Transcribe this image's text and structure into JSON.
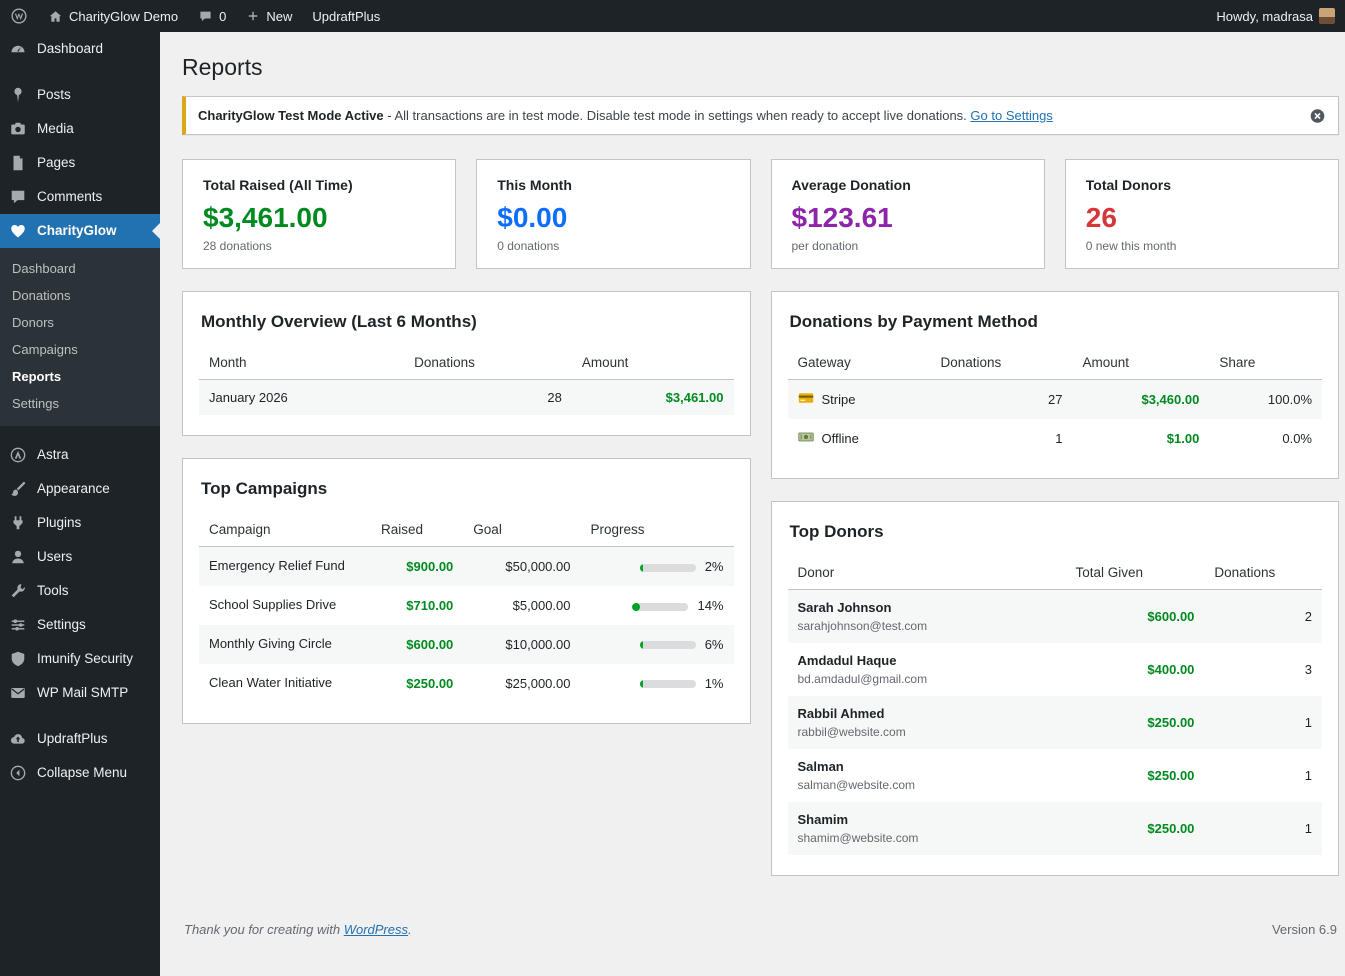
{
  "colors": {
    "admin_bar_bg": "#1d2327",
    "sidebar_bg": "#1d2327",
    "submenu_bg": "#2c3338",
    "active_menu": "#2271b1",
    "content_bg": "#f0f0f1",
    "warning_border": "#dba617",
    "money_green": "#008a20",
    "progress_green": "#00a32a",
    "stat_blue": "#0d6efd",
    "stat_purple": "#8e24aa",
    "stat_red": "#d63638",
    "link": "#2271b1"
  },
  "admin_bar": {
    "site_name": "CharityGlow Demo",
    "comments_count": "0",
    "new_label": "New",
    "updraft_label": "UpdraftPlus",
    "howdy": "Howdy, madrasa"
  },
  "sidebar": {
    "items": [
      {
        "label": "Dashboard",
        "icon": "dashboard-icon"
      },
      {
        "label": "Posts",
        "icon": "pin-icon"
      },
      {
        "label": "Media",
        "icon": "camera-icon"
      },
      {
        "label": "Pages",
        "icon": "pages-icon"
      },
      {
        "label": "Comments",
        "icon": "comment-icon"
      },
      {
        "label": "CharityGlow",
        "icon": "heart-icon",
        "active": true
      },
      {
        "label": "Astra",
        "icon": "astra-icon"
      },
      {
        "label": "Appearance",
        "icon": "brush-icon"
      },
      {
        "label": "Plugins",
        "icon": "plug-icon"
      },
      {
        "label": "Users",
        "icon": "user-icon"
      },
      {
        "label": "Tools",
        "icon": "wrench-icon"
      },
      {
        "label": "Settings",
        "icon": "sliders-icon"
      },
      {
        "label": "Imunify Security",
        "icon": "shield-icon"
      },
      {
        "label": "WP Mail SMTP",
        "icon": "envelope-icon"
      },
      {
        "label": "UpdraftPlus",
        "icon": "cloud-backup-icon"
      },
      {
        "label": "Collapse Menu",
        "icon": "collapse-icon"
      }
    ],
    "submenu": [
      {
        "label": "Dashboard"
      },
      {
        "label": "Donations"
      },
      {
        "label": "Donors"
      },
      {
        "label": "Campaigns"
      },
      {
        "label": "Reports",
        "active": true
      },
      {
        "label": "Settings"
      }
    ]
  },
  "page": {
    "title": "Reports"
  },
  "notice": {
    "bold": "CharityGlow Test Mode Active",
    "text": " - All transactions are in test mode. Disable test mode in settings when ready to accept live donations. ",
    "link": "Go to Settings"
  },
  "stats": [
    {
      "title": "Total Raised (All Time)",
      "value": "$3,461.00",
      "sub": "28 donations",
      "color": "#008a20"
    },
    {
      "title": "This Month",
      "value": "$0.00",
      "sub": "0 donations",
      "color": "#0d6efd"
    },
    {
      "title": "Average Donation",
      "value": "$123.61",
      "sub": "per donation",
      "color": "#8e24aa"
    },
    {
      "title": "Total Donors",
      "value": "26",
      "sub": "0 new this month",
      "color": "#d63638"
    }
  ],
  "monthly_overview": {
    "title": "Monthly Overview (Last 6 Months)",
    "columns": [
      "Month",
      "Donations",
      "Amount"
    ],
    "rows": [
      {
        "month": "January 2026",
        "donations": "28",
        "amount": "$3,461.00"
      }
    ]
  },
  "payment_methods": {
    "title": "Donations by Payment Method",
    "columns": [
      "Gateway",
      "Donations",
      "Amount",
      "Share"
    ],
    "rows": [
      {
        "gateway": "Stripe",
        "icon": "credit-card-icon",
        "donations": "27",
        "amount": "$3,460.00",
        "share": "100.0%"
      },
      {
        "gateway": "Offline",
        "icon": "banknote-icon",
        "donations": "1",
        "amount": "$1.00",
        "share": "0.0%"
      }
    ]
  },
  "top_campaigns": {
    "title": "Top Campaigns",
    "columns": [
      "Campaign",
      "Raised",
      "Goal",
      "Progress"
    ],
    "rows": [
      {
        "name": "Emergency Relief Fund",
        "raised": "$900.00",
        "goal": "$50,000.00",
        "percent": 2,
        "percent_label": "2%"
      },
      {
        "name": "School Supplies Drive",
        "raised": "$710.00",
        "goal": "$5,000.00",
        "percent": 14,
        "percent_label": "14%"
      },
      {
        "name": "Monthly Giving Circle",
        "raised": "$600.00",
        "goal": "$10,000.00",
        "percent": 6,
        "percent_label": "6%"
      },
      {
        "name": "Clean Water Initiative",
        "raised": "$250.00",
        "goal": "$25,000.00",
        "percent": 1,
        "percent_label": "1%"
      }
    ]
  },
  "top_donors": {
    "title": "Top Donors",
    "columns": [
      "Donor",
      "Total Given",
      "Donations"
    ],
    "rows": [
      {
        "name": "Sarah Johnson",
        "email": "sarahjohnson@test.com",
        "total": "$600.00",
        "count": "2"
      },
      {
        "name": "Amdadul Haque",
        "email": "bd.amdadul@gmail.com",
        "total": "$400.00",
        "count": "3"
      },
      {
        "name": "Rabbil Ahmed",
        "email": "rabbil@website.com",
        "total": "$250.00",
        "count": "1"
      },
      {
        "name": "Salman",
        "email": "salman@website.com",
        "total": "$250.00",
        "count": "1"
      },
      {
        "name": "Shamim",
        "email": "shamim@website.com",
        "total": "$250.00",
        "count": "1"
      }
    ]
  },
  "footer": {
    "thanks_prefix": "Thank you for creating with ",
    "thanks_link": "WordPress",
    "thanks_suffix": ".",
    "version": "Version 6.9"
  }
}
